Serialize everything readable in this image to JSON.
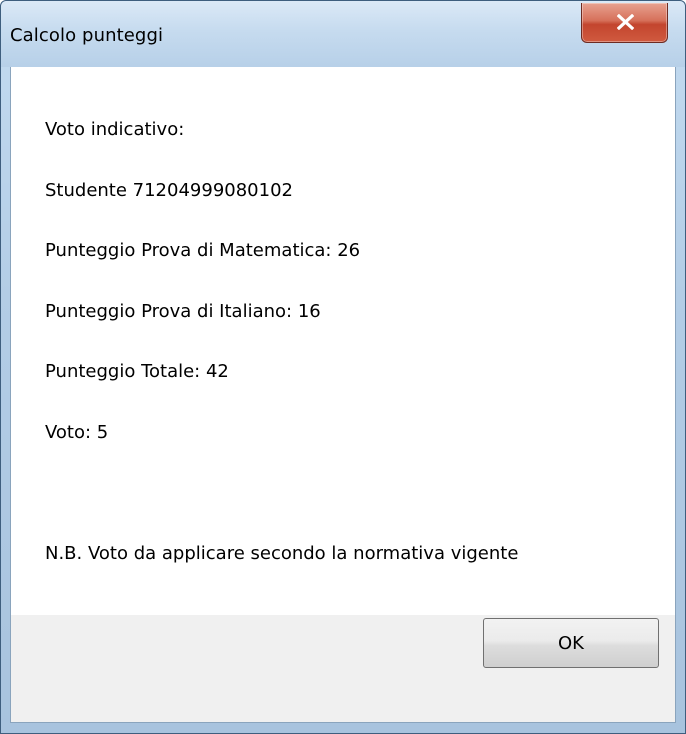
{
  "window": {
    "title": "Calcolo punteggi",
    "close_icon": "close-icon"
  },
  "content": {
    "lines": [
      "Voto indicativo:",
      "Studente 71204999080102",
      "Punteggio Prova di Matematica: 26",
      "Punteggio Prova di Italiano: 16",
      "Punteggio Totale: 42",
      "Voto: 5"
    ],
    "note": "N.B. Voto da applicare secondo la normativa vigente"
  },
  "footer": {
    "ok_label": "OK"
  },
  "colors": {
    "close_button": "#c3452e",
    "title_bar": "#c6dbef",
    "footer_bg": "#f0f0f0"
  }
}
